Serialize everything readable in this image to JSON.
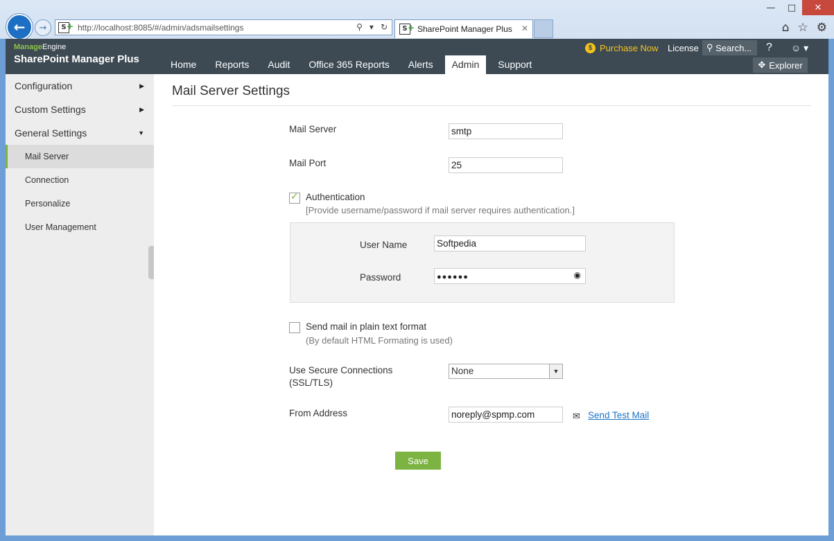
{
  "browser": {
    "url": "http://localhost:8085/#/admin/adsmailsettings",
    "tab_title": "SharePoint Manager Plus",
    "favicon_text": "S"
  },
  "app": {
    "brand_small_green": "Manage",
    "brand_small_white": "Engine",
    "brand_title": "SharePoint Manager Plus",
    "nav": [
      "Home",
      "Reports",
      "Audit",
      "Office 365 Reports",
      "Alerts",
      "Admin",
      "Support"
    ],
    "active_nav": "Admin",
    "purchase": "Purchase Now",
    "license": "License",
    "search": "Search...",
    "help": "?",
    "explorer": "Explorer"
  },
  "sidebar": {
    "sections": [
      {
        "label": "Configuration",
        "arrow": "▶"
      },
      {
        "label": "Custom Settings",
        "arrow": "▶"
      },
      {
        "label": "General Settings",
        "arrow": "▼"
      }
    ],
    "items": [
      "Mail Server",
      "Connection",
      "Personalize",
      "User Management"
    ],
    "active_item": "Mail Server"
  },
  "form": {
    "title": "Mail Server Settings",
    "mail_server_label": "Mail Server",
    "mail_server_value": "smtp",
    "mail_port_label": "Mail Port",
    "mail_port_value": "25",
    "auth_label": "Authentication",
    "auth_checked": true,
    "auth_hint": "[Provide username/password if mail server requires authentication.]",
    "username_label": "User Name",
    "username_value": "Softpedia",
    "password_label": "Password",
    "password_value": "●●●●●●",
    "plain_text_label": "Send mail in plain text format",
    "plain_text_checked": false,
    "plain_text_hint": "(By default HTML Formating is used)",
    "secure_label_1": "Use Secure Connections",
    "secure_label_2": "(SSL/TLS)",
    "secure_value": "None",
    "from_label": "From Address",
    "from_value": "noreply@spmp.com",
    "test_link": "Send Test Mail",
    "save": "Save"
  },
  "colors": {
    "header_bg": "#3d4a54",
    "accent_green": "#7cb342",
    "purchase_yellow": "#f4c31b",
    "link_blue": "#1a73c7"
  }
}
